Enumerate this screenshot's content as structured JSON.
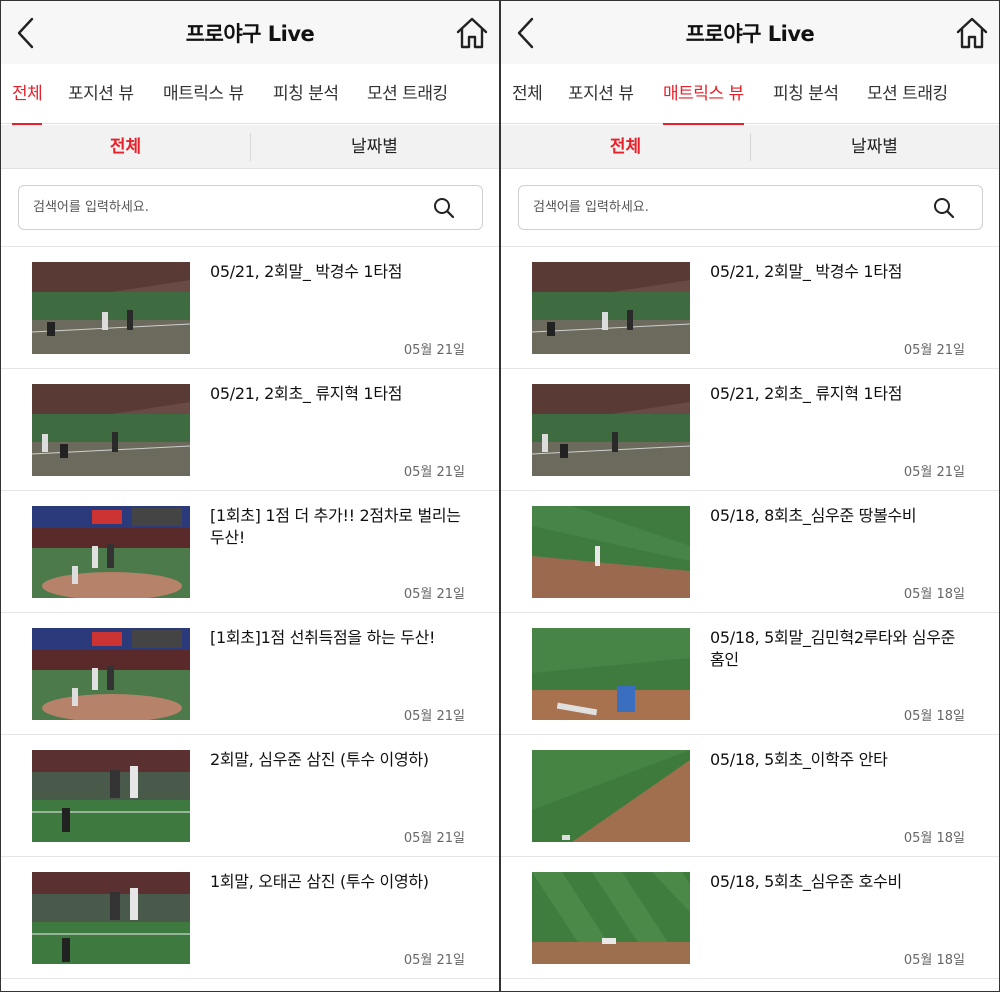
{
  "colors": {
    "accent": "#e8202a",
    "header_bg": "#f7f7f7",
    "subtab_bg": "#f2f2f2"
  },
  "screens": [
    {
      "title": "프로야구 Live",
      "icons": {
        "back": "chevron-left-icon",
        "home": "home-icon",
        "search": "search-icon"
      },
      "tabs": [
        {
          "label": "전체",
          "active": true
        },
        {
          "label": "포지션 뷰",
          "active": false
        },
        {
          "label": "매트릭스 뷰",
          "active": false
        },
        {
          "label": "피칭 분석",
          "active": false
        },
        {
          "label": "모션 트래킹",
          "active": false
        }
      ],
      "subtabs": [
        {
          "label": "전체",
          "active": true
        },
        {
          "label": "날짜별",
          "active": false
        }
      ],
      "search_placeholder": "검색어를 입력하세요.",
      "items": [
        {
          "title": "05/21, 2회말_ 박경수 1타점",
          "date": "05월 21일"
        },
        {
          "title": "05/21, 2회초_ 류지혁 1타점",
          "date": "05월 21일"
        },
        {
          "title": "[1회초] 1점 더 추가!! 2점차로 벌리는 두산!",
          "date": "05월 21일"
        },
        {
          "title": "[1회초]1점 선취득점을 하는 두산!",
          "date": "05월 21일"
        },
        {
          "title": "2회말, 심우준 삼진 (투수 이영하)",
          "date": "05월 21일"
        },
        {
          "title": "1회말, 오태곤 삼진 (투수 이영하)",
          "date": "05월 21일"
        }
      ]
    },
    {
      "title": "프로야구 Live",
      "icons": {
        "back": "chevron-left-icon",
        "home": "home-icon",
        "search": "search-icon"
      },
      "tabs": [
        {
          "label": "전체",
          "active": false
        },
        {
          "label": "포지션 뷰",
          "active": false
        },
        {
          "label": "매트릭스 뷰",
          "active": true
        },
        {
          "label": "피칭 분석",
          "active": false
        },
        {
          "label": "모션 트래킹",
          "active": false
        }
      ],
      "subtabs": [
        {
          "label": "전체",
          "active": true
        },
        {
          "label": "날짜별",
          "active": false
        }
      ],
      "search_placeholder": "검색어를 입력하세요.",
      "items": [
        {
          "title": "05/21, 2회말_ 박경수 1타점",
          "date": "05월 21일"
        },
        {
          "title": "05/21, 2회초_ 류지혁 1타점",
          "date": "05월 21일"
        },
        {
          "title": "05/18, 8회초_심우준 땅볼수비",
          "date": "05월 18일"
        },
        {
          "title": "05/18, 5회말_김민혁2루타와 심우준 홈인",
          "date": "05월 18일"
        },
        {
          "title": "05/18, 5회초_이학주 안타",
          "date": "05월 18일"
        },
        {
          "title": "05/18, 5회초_심우준 호수비",
          "date": "05월 18일"
        }
      ]
    }
  ]
}
